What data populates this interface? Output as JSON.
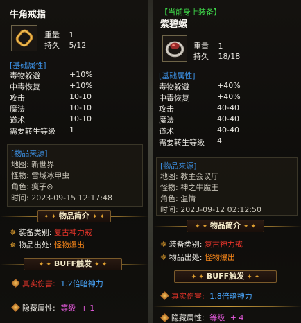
{
  "left": {
    "title": "牛角戒指",
    "weight_label": "重量",
    "weight_value": "1",
    "durability_label": "持久",
    "durability_value": "5/12",
    "base_header": "[基础属性]",
    "stats": [
      {
        "name": "毒物躲避",
        "value": "+10%"
      },
      {
        "name": "中毒恢复",
        "value": "+10%"
      },
      {
        "name": "攻击",
        "value": "10-10"
      },
      {
        "name": "魔法",
        "value": "10-10"
      },
      {
        "name": "道术",
        "value": "10-10"
      },
      {
        "name": "需要转生等级",
        "value": "1"
      }
    ],
    "source_header": "[物品来源]",
    "source": {
      "map_label": "地图:",
      "map_value": "新世界",
      "monster_label": "怪物:",
      "monster_value": "雪域冰甲虫",
      "role_label": "角色:",
      "role_value": "疯子⊙",
      "time_label": "时间:",
      "time_value": "2023-09-15 12:17:48"
    },
    "intro_banner": "物品简介",
    "equip_type_label": "装备类别:",
    "equip_type_value": "复古神力戒",
    "item_origin_label": "物品出处:",
    "item_origin_value": "怪物爆出",
    "buff_banner": "BUFF触发",
    "true_dmg_label": "真实伤害:",
    "true_dmg_value": "1.2倍暗神力",
    "hidden_label": "隐藏属性:",
    "hidden_level_label": "等级",
    "hidden_level_value": "+ 1"
  },
  "right": {
    "equip_tag": "【当前身上装备】",
    "title": "紫碧螺",
    "weight_label": "重量",
    "weight_value": "1",
    "durability_label": "持久",
    "durability_value": "18/18",
    "base_header": "[基础属性]",
    "stats": [
      {
        "name": "毒物躲避",
        "value": "+40%"
      },
      {
        "name": "中毒恢复",
        "value": "+40%"
      },
      {
        "name": "攻击",
        "value": "40-40"
      },
      {
        "name": "魔法",
        "value": "40-40"
      },
      {
        "name": "道术",
        "value": "40-40"
      },
      {
        "name": "需要转生等级",
        "value": "4"
      }
    ],
    "source_header": "[物品来源]",
    "source": {
      "map_label": "地图:",
      "map_value": "教主会议厅",
      "monster_label": "怪物:",
      "monster_value": "神之牛魔王",
      "role_label": "角色:",
      "role_value": "温情",
      "time_label": "时间:",
      "time_value": "2023-09-12 02:12:50"
    },
    "intro_banner": "物品简介",
    "equip_type_label": "装备类别:",
    "equip_type_value": "复古神力戒",
    "item_origin_label": "物品出处:",
    "item_origin_value": "怪物爆出",
    "buff_banner": "BUFF触发",
    "true_dmg_label": "真实伤害:",
    "true_dmg_value": "1.8倍暗神力",
    "hidden_label": "隐藏属性:",
    "hidden_level_label": "等级",
    "hidden_level_value": "+ 4"
  },
  "icons": {
    "left_item": "bull-horn-ring-icon",
    "right_item": "purple-jade-ring-icon",
    "bullet": "diamond-bullet-icon",
    "banner_star": "star-icon"
  },
  "colors": {
    "equip_tag": "#3fd84a",
    "section_header": "#3c8fe2",
    "equip_type_value": "#e4342a",
    "item_origin_value": "#ff8a1a",
    "true_dmg_label": "#e4342a",
    "true_dmg_value": "#4aa8ff",
    "hidden_level": "#e85be0"
  }
}
